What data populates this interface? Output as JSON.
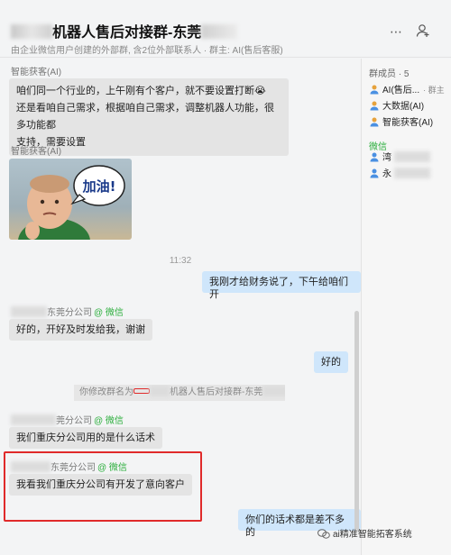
{
  "header": {
    "title_part1": "机器人售后对接群-东莞",
    "subtitle": "由企业微信用户创建的外部群, 含2位外部联系人 · 群主: AI(售后客服)"
  },
  "sidebar": {
    "title": "群成员 · 5",
    "members": [
      {
        "name": "AI(售后...",
        "tag": "· 群主"
      },
      {
        "name": "大数据(AI)"
      },
      {
        "name": "智能获客(AI)"
      }
    ],
    "wechat_section": "微信",
    "wechat_members": [
      {
        "name": "湾"
      },
      {
        "name": "永"
      }
    ]
  },
  "messages": {
    "sender_ai": "智能获客(AI)",
    "msg1_line1": "咱们同一个行业的，上午刚有个客户，就不要设置打断😭",
    "msg1_line2": "还是看咱自己需求，根据咱自己需求，调整机器人功能，很多功能都",
    "msg1_line3": "支持，需要设置",
    "sender_ai2": "智能获客(AI)",
    "sticker_text": "加油!",
    "time": "11:32",
    "right1": "我刚才给财务说了，下午给咱们开",
    "sender_dg": "东莞分公司",
    "sender_tag": "@ 微信",
    "left2": "好的，开好及时发给我，谢谢",
    "right2": "好的",
    "sys_prefix": "你修改群名为",
    "sys_mid": "机器人售后对接群-东莞",
    "sender_dg2": "莞分公司",
    "left3": "我们重庆分公司用的是什么话术",
    "sender_dg3": "东莞分公司",
    "left4": "我看我们重庆分公司有开发了意向客户",
    "right3": "你们的话术都是差不多的"
  },
  "watermark": "ai精准智能拓客系统",
  "colors": {
    "accent_green": "#2bae3c",
    "bubble_right": "#cfe6fb",
    "highlight": "#e02a2a"
  }
}
